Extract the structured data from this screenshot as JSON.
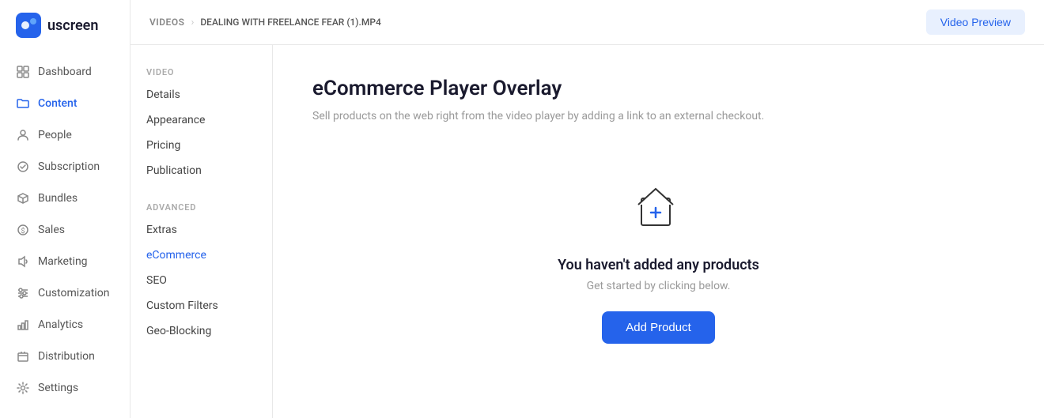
{
  "logo": {
    "text": "uscreen"
  },
  "sidebar": {
    "items": [
      {
        "id": "dashboard",
        "label": "Dashboard",
        "icon": "grid"
      },
      {
        "id": "content",
        "label": "Content",
        "icon": "folder",
        "active": true
      },
      {
        "id": "people",
        "label": "People",
        "icon": "user"
      },
      {
        "id": "subscription",
        "label": "Subscription",
        "icon": "circle"
      },
      {
        "id": "bundles",
        "label": "Bundles",
        "icon": "package"
      },
      {
        "id": "sales",
        "label": "Sales",
        "icon": "dollar"
      },
      {
        "id": "marketing",
        "label": "Marketing",
        "icon": "speaker"
      },
      {
        "id": "customization",
        "label": "Customization",
        "icon": "sliders"
      },
      {
        "id": "analytics",
        "label": "Analytics",
        "icon": "bar-chart"
      },
      {
        "id": "distribution",
        "label": "Distribution",
        "icon": "box"
      },
      {
        "id": "settings",
        "label": "Settings",
        "icon": "gear"
      }
    ]
  },
  "header": {
    "breadcrumb_root": "VIDEOS",
    "breadcrumb_current": "DEALING WITH FREELANCE FEAR (1).MP4",
    "video_preview_label": "Video Preview"
  },
  "sub_sidebar": {
    "sections": [
      {
        "label": "VIDEO",
        "items": [
          {
            "id": "details",
            "label": "Details",
            "active": false
          },
          {
            "id": "appearance",
            "label": "Appearance",
            "active": false
          },
          {
            "id": "pricing",
            "label": "Pricing",
            "active": false
          },
          {
            "id": "publication",
            "label": "Publication",
            "active": false
          }
        ]
      },
      {
        "label": "ADVANCED",
        "items": [
          {
            "id": "extras",
            "label": "Extras",
            "active": false
          },
          {
            "id": "ecommerce",
            "label": "eCommerce",
            "active": true
          },
          {
            "id": "seo",
            "label": "SEO",
            "active": false
          },
          {
            "id": "custom-filters",
            "label": "Custom Filters",
            "active": false
          },
          {
            "id": "geo-blocking",
            "label": "Geo-Blocking",
            "active": false
          }
        ]
      }
    ]
  },
  "page": {
    "title": "eCommerce Player Overlay",
    "subtitle": "Sell products on the web right from the video player by adding a link to an external checkout.",
    "empty_state": {
      "title": "You haven't added any products",
      "subtitle": "Get started by clicking below.",
      "add_button_label": "Add Product"
    }
  }
}
